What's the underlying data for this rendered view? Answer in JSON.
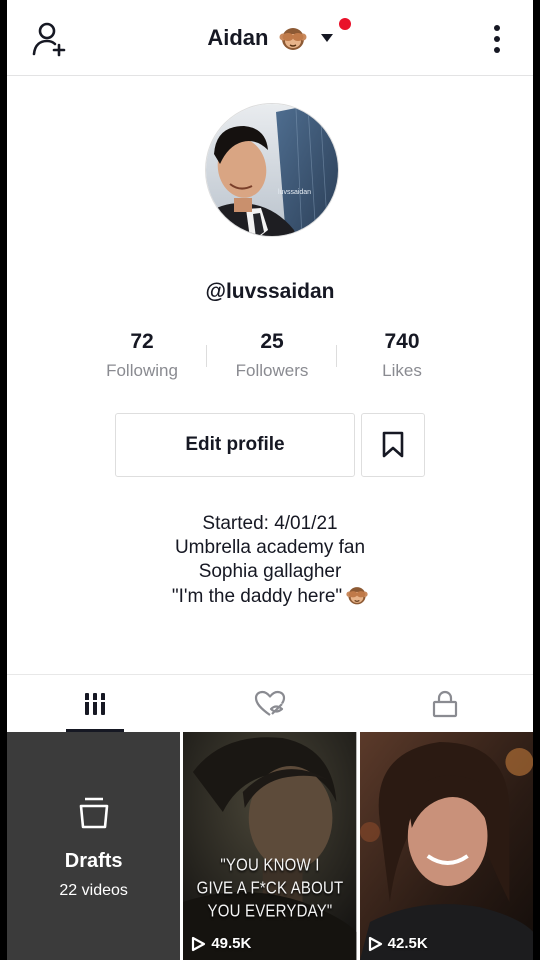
{
  "header": {
    "title": "Aidan",
    "icons": {
      "left": "add-user-icon",
      "right": "more-vertical-icon",
      "dropdown": "caret-down-icon",
      "emoji": "see-no-evil-monkey"
    }
  },
  "profile": {
    "username": "@luvssaidan",
    "avatar_watermark": "luvssaidan"
  },
  "stats": [
    {
      "value": "72",
      "label": "Following"
    },
    {
      "value": "25",
      "label": "Followers"
    },
    {
      "value": "740",
      "label": "Likes"
    }
  ],
  "actions": {
    "edit_profile": "Edit profile",
    "bookmark_icon": "bookmark-icon"
  },
  "bio": {
    "lines": [
      "Started: 4/01/21",
      "Umbrella academy fan",
      "Sophia gallagher",
      "\"I'm the daddy here\""
    ]
  },
  "tabs": [
    {
      "icon": "grid-icon",
      "active": true
    },
    {
      "icon": "liked-hidden-icon",
      "active": false
    },
    {
      "icon": "lock-icon",
      "active": false
    }
  ],
  "videos": {
    "drafts": {
      "title": "Drafts",
      "count": "22 videos"
    },
    "items": [
      {
        "caption_lines": [
          "\"YOU KNOW I",
          "GIVE A F*CK ABOUT",
          "YOU EVERYDAY\""
        ],
        "views": "49.5K"
      },
      {
        "caption_lines": [],
        "views": "42.5K"
      }
    ]
  },
  "colors": {
    "notification_dot": "#e9112a",
    "text_primary": "#161823",
    "text_secondary": "#8a8b91",
    "drafts_bg": "#3b3b3b"
  }
}
